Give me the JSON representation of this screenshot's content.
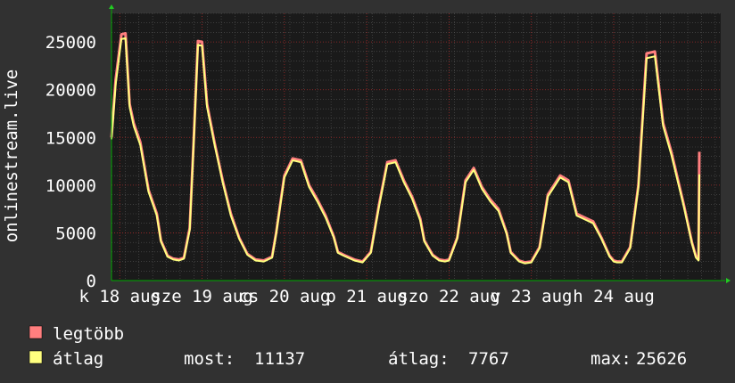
{
  "chart_data": {
    "type": "line",
    "title": "",
    "ylabel": "onlinestream.live",
    "xlabel": "",
    "ylim": [
      0,
      28000
    ],
    "y_ticks": [
      0,
      5000,
      10000,
      15000,
      20000,
      25000
    ],
    "x_ticks": [
      "k 18 aug",
      "sze 19 aug",
      "cs 20 aug",
      "p 21 aug",
      "szo 22 aug",
      "v 23 aug",
      "h 24 aug"
    ],
    "x_domain": [
      0,
      7.4
    ],
    "grid": true,
    "legend": [
      {
        "name": "legtöbb",
        "color": "#ff7f7f"
      },
      {
        "name": "átlag",
        "color": "#ffff7f"
      }
    ],
    "series": [
      {
        "name": "legtöbb",
        "color": "#ff7f7f",
        "x": [
          0,
          0.05,
          0.12,
          0.17,
          0.22,
          0.27,
          0.35,
          0.45,
          0.55,
          0.6,
          0.68,
          0.75,
          0.82,
          0.88,
          0.95,
          1.0,
          1.05,
          1.1,
          1.16,
          1.25,
          1.35,
          1.45,
          1.55,
          1.65,
          1.75,
          1.85,
          1.95,
          2.0,
          2.1,
          2.2,
          2.3,
          2.4,
          2.5,
          2.6,
          2.7,
          2.75,
          2.82,
          2.95,
          3.05,
          3.15,
          3.25,
          3.35,
          3.45,
          3.55,
          3.65,
          3.75,
          3.8,
          3.9,
          3.98,
          4.05,
          4.1,
          4.2,
          4.3,
          4.4,
          4.5,
          4.6,
          4.7,
          4.8,
          4.85,
          4.95,
          5.02,
          5.1,
          5.2,
          5.3,
          5.45,
          5.55,
          5.65,
          5.75,
          5.85,
          5.95,
          6.05,
          6.1,
          6.14,
          6.2,
          6.3,
          6.4,
          6.5,
          6.6,
          6.7,
          6.8,
          6.95,
          7.05,
          7.1,
          7.13,
          7.14
        ],
        "values": [
          15000,
          21000,
          25800,
          25900,
          18500,
          16500,
          14500,
          9500,
          7000,
          4200,
          2600,
          2300,
          2200,
          2400,
          5500,
          15000,
          25100,
          25000,
          18500,
          14500,
          10500,
          7000,
          4500,
          2800,
          2200,
          2100,
          2500,
          5000,
          11000,
          12800,
          12600,
          10000,
          8500,
          6800,
          4600,
          3000,
          2700,
          2200,
          2000,
          3000,
          8000,
          12400,
          12600,
          10500,
          8800,
          6500,
          4200,
          2700,
          2200,
          2100,
          2200,
          4500,
          10500,
          11800,
          9800,
          8500,
          7500,
          5000,
          3000,
          2100,
          1900,
          2000,
          3500,
          9000,
          11000,
          10500,
          7000,
          6600,
          6200,
          4500,
          2600,
          2100,
          2000,
          2000,
          3500,
          10000,
          23800,
          24000,
          16500,
          13500,
          8000,
          4000,
          2500,
          2200,
          13500
        ]
      },
      {
        "name": "átlag",
        "color": "#ffff7f",
        "x": [
          0,
          0.05,
          0.12,
          0.17,
          0.22,
          0.27,
          0.35,
          0.45,
          0.55,
          0.6,
          0.68,
          0.75,
          0.82,
          0.88,
          0.95,
          1.0,
          1.05,
          1.1,
          1.16,
          1.25,
          1.35,
          1.45,
          1.55,
          1.65,
          1.75,
          1.85,
          1.95,
          2.0,
          2.1,
          2.2,
          2.3,
          2.4,
          2.5,
          2.6,
          2.7,
          2.75,
          2.82,
          2.95,
          3.05,
          3.15,
          3.25,
          3.35,
          3.45,
          3.55,
          3.65,
          3.75,
          3.8,
          3.9,
          3.98,
          4.05,
          4.1,
          4.2,
          4.3,
          4.4,
          4.5,
          4.6,
          4.7,
          4.8,
          4.85,
          4.95,
          5.02,
          5.1,
          5.2,
          5.3,
          5.45,
          5.55,
          5.65,
          5.75,
          5.85,
          5.95,
          6.05,
          6.1,
          6.14,
          6.2,
          6.3,
          6.4,
          6.5,
          6.6,
          6.7,
          6.8,
          6.95,
          7.05,
          7.1,
          7.13,
          7.14
        ],
        "values": [
          14800,
          20500,
          25300,
          25400,
          18200,
          16200,
          14200,
          9300,
          6800,
          4100,
          2500,
          2200,
          2100,
          2300,
          5300,
          14800,
          24700,
          24600,
          18200,
          14300,
          10300,
          6800,
          4400,
          2700,
          2100,
          2000,
          2400,
          4900,
          10800,
          12600,
          12400,
          9800,
          8300,
          6600,
          4500,
          2900,
          2600,
          2100,
          1900,
          2900,
          7800,
          12200,
          12400,
          10300,
          8600,
          6300,
          4100,
          2600,
          2100,
          2000,
          2100,
          4400,
          10300,
          11600,
          9600,
          8300,
          7300,
          4900,
          2900,
          2000,
          1800,
          1900,
          3400,
          8800,
          10800,
          10300,
          6800,
          6400,
          6000,
          4400,
          2500,
          2000,
          1900,
          1900,
          3400,
          9800,
          23300,
          23500,
          16200,
          13200,
          7800,
          3900,
          2400,
          2100,
          11137
        ]
      }
    ]
  },
  "legend_stats": {
    "current_label": "most:",
    "current_value": "11137",
    "average_label": "átlag:",
    "average_value": "7767",
    "max_label": "max:",
    "max_value": "25626"
  },
  "colors": {
    "background": "#313131",
    "plot_background": "#1a1a1a",
    "grid_major": "#ff3333",
    "grid_minor": "#555555",
    "axis": "#00aa00",
    "text": "#ffffff"
  }
}
